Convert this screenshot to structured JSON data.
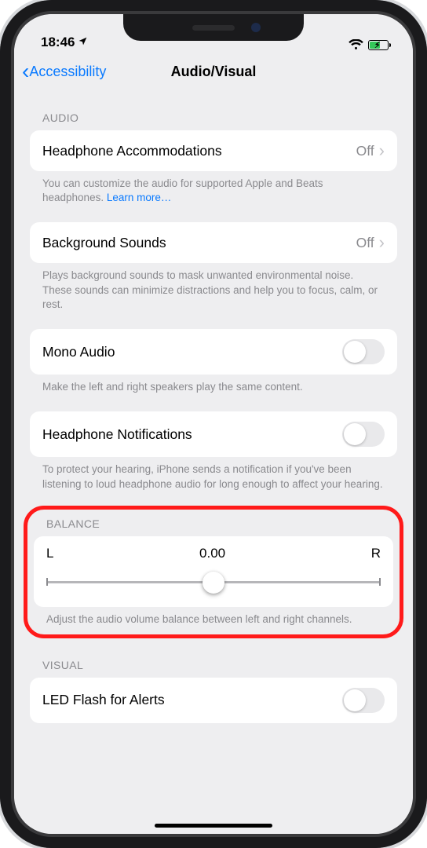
{
  "status": {
    "time": "18:46"
  },
  "nav": {
    "back_label": "Accessibility",
    "title": "Audio/Visual"
  },
  "sections": {
    "audio_header": "AUDIO",
    "balance_header": "BALANCE",
    "visual_header": "VISUAL"
  },
  "rows": {
    "headphone_accom": {
      "label": "Headphone Accommodations",
      "value": "Off"
    },
    "background_sounds": {
      "label": "Background Sounds",
      "value": "Off"
    },
    "mono_audio": {
      "label": "Mono Audio"
    },
    "headphone_notif": {
      "label": "Headphone Notifications"
    },
    "led_flash": {
      "label": "LED Flash for Alerts"
    }
  },
  "footers": {
    "headphone_accom": "You can customize the audio for supported Apple and Beats headphones. ",
    "headphone_accom_link": "Learn more…",
    "background_sounds": "Plays background sounds to mask unwanted environmental noise. These sounds can minimize distractions and help you to focus, calm, or rest.",
    "mono_audio": "Make the left and right speakers play the same content.",
    "headphone_notif": "To protect your hearing, iPhone sends a notification if you've been listening to loud headphone audio for long enough to affect your hearing.",
    "balance": "Adjust the audio volume balance between left and right channels."
  },
  "balance": {
    "left": "L",
    "value": "0.00",
    "right": "R"
  }
}
